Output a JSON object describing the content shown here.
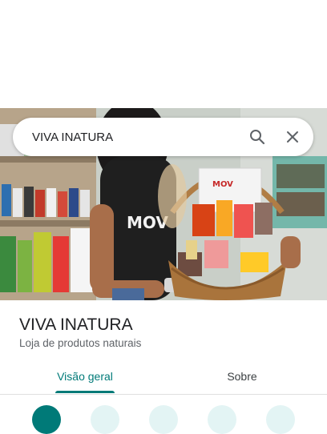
{
  "search": {
    "query": "VIVA INATURA",
    "search_icon": "search-icon",
    "close_icon": "close-icon"
  },
  "hero": {
    "shirt_text": "MOV",
    "basket_tag": "MOV"
  },
  "place": {
    "name": "VIVA INATURA",
    "category": "Loja de produtos naturais"
  },
  "tabs": [
    {
      "label": "Visão geral",
      "active": true
    },
    {
      "label": "Sobre",
      "active": false
    }
  ],
  "colors": {
    "accent": "#007a78",
    "action_light": "#e3f4f4"
  }
}
